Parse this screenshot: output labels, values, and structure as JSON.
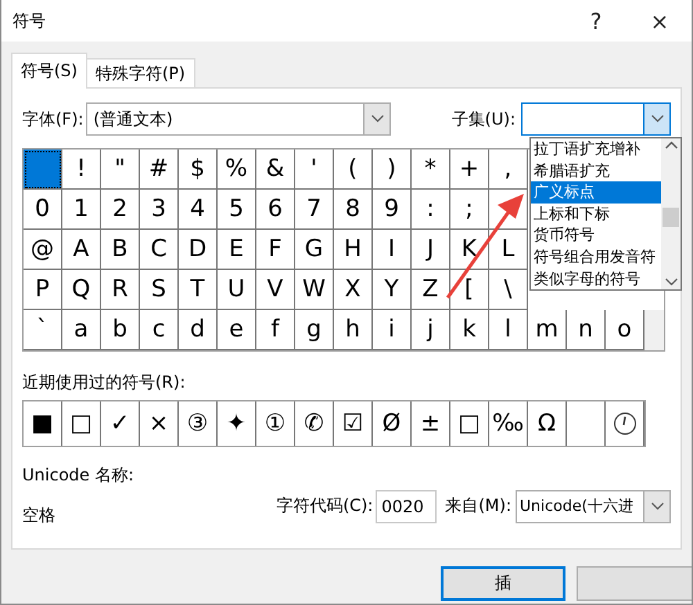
{
  "window": {
    "title": "符号",
    "help": "?",
    "close": "×"
  },
  "tabs": [
    {
      "label": "符号(S)",
      "selected": true
    },
    {
      "label": "特殊字符(P)",
      "selected": false
    }
  ],
  "font": {
    "label": "字体(F):",
    "value": "(普通文本)"
  },
  "subset": {
    "label": "子集(U):",
    "expanded": true,
    "options": [
      {
        "label": "拉丁语扩充增补",
        "selected": false
      },
      {
        "label": "希腊语扩充",
        "selected": false
      },
      {
        "label": "广义标点",
        "selected": true
      },
      {
        "label": "上标和下标",
        "selected": false
      },
      {
        "label": "货币符号",
        "selected": false
      },
      {
        "label": "符号组合用发音符",
        "selected": false
      },
      {
        "label": "类似字母的符号",
        "selected": false
      }
    ]
  },
  "symbol_grid": [
    [
      {
        "selected": true
      },
      {
        "char": "!",
        "selected": false
      },
      {
        "char": "\"",
        "selected": false
      },
      {
        "char": "#",
        "selected": false
      },
      {
        "char": "$",
        "selected": false
      },
      {
        "char": "%",
        "selected": false
      },
      {
        "char": "&",
        "selected": false
      },
      {
        "char": "'",
        "selected": false
      },
      {
        "char": "(",
        "selected": false
      },
      {
        "char": ")",
        "selected": false
      },
      {
        "char": "*",
        "selected": false
      },
      {
        "char": "+",
        "selected": false
      },
      {
        "char": ",",
        "selected": false
      }
    ],
    [
      {
        "char": "0",
        "selected": false
      },
      {
        "char": "1",
        "selected": false
      },
      {
        "char": "2",
        "selected": false
      },
      {
        "char": "3",
        "selected": false
      },
      {
        "char": "4",
        "selected": false
      },
      {
        "char": "5",
        "selected": false
      },
      {
        "char": "6",
        "selected": false
      },
      {
        "char": "7",
        "selected": false
      },
      {
        "char": "8",
        "selected": false
      },
      {
        "char": "9",
        "selected": false
      },
      {
        "char": ":",
        "selected": false
      },
      {
        "char": ";",
        "selected": false
      },
      {
        "selected": false
      }
    ],
    [
      {
        "char": "@",
        "selected": false
      },
      {
        "char": "A",
        "selected": false
      },
      {
        "char": "B",
        "selected": false
      },
      {
        "char": "C",
        "selected": false
      },
      {
        "char": "D",
        "selected": false
      },
      {
        "char": "E",
        "selected": false
      },
      {
        "char": "F",
        "selected": false
      },
      {
        "char": "G",
        "selected": false
      },
      {
        "char": "H",
        "selected": false
      },
      {
        "char": "I",
        "selected": false
      },
      {
        "char": "J",
        "selected": false
      },
      {
        "char": "K",
        "selected": false
      },
      {
        "char": "L",
        "selected": false
      }
    ],
    [
      {
        "char": "P",
        "selected": false
      },
      {
        "char": "Q",
        "selected": false
      },
      {
        "char": "R",
        "selected": false
      },
      {
        "char": "S",
        "selected": false
      },
      {
        "char": "T",
        "selected": false
      },
      {
        "char": "U",
        "selected": false
      },
      {
        "char": "V",
        "selected": false
      },
      {
        "char": "W",
        "selected": false
      },
      {
        "char": "X",
        "selected": false
      },
      {
        "char": "Y",
        "selected": false
      },
      {
        "char": "Z",
        "selected": false
      },
      {
        "char": "[",
        "selected": false
      },
      {
        "char": "\\",
        "selected": false
      }
    ],
    [
      {
        "char": "`",
        "selected": false
      },
      {
        "char": "a",
        "selected": false
      },
      {
        "char": "b",
        "selected": false
      },
      {
        "char": "c",
        "selected": false
      },
      {
        "char": "d",
        "selected": false
      },
      {
        "char": "e",
        "selected": false
      },
      {
        "char": "f",
        "selected": false
      },
      {
        "char": "g",
        "selected": false
      },
      {
        "char": "h",
        "selected": false
      },
      {
        "char": "i",
        "selected": false
      },
      {
        "char": "j",
        "selected": false
      },
      {
        "char": "k",
        "selected": false
      },
      {
        "char": "l",
        "selected": false
      },
      {
        "char": "m",
        "selected": false
      },
      {
        "char": "n",
        "selected": false
      },
      {
        "char": "o",
        "selected": false
      }
    ]
  ],
  "recent": {
    "label": "近期使用过的符号(R):",
    "symbols": [
      {
        "kind": "glyph",
        "char": "■"
      },
      {
        "kind": "glyph",
        "char": "□"
      },
      {
        "kind": "glyph",
        "char": "✓"
      },
      {
        "kind": "glyph",
        "char": "×"
      },
      {
        "kind": "glyph",
        "char": "③"
      },
      {
        "kind": "glyph",
        "char": "✦"
      },
      {
        "kind": "glyph",
        "char": "①"
      },
      {
        "kind": "glyph",
        "char": "✆"
      },
      {
        "kind": "glyph",
        "char": "☑"
      },
      {
        "kind": "glyph",
        "char": "Ø"
      },
      {
        "kind": "glyph",
        "char": "±"
      },
      {
        "kind": "glyph",
        "char": "□"
      },
      {
        "kind": "glyph",
        "char": "‰"
      },
      {
        "kind": "glyph",
        "char": "Ω"
      },
      {
        "kind": "blank"
      },
      {
        "kind": "icon"
      }
    ]
  },
  "unicode_name": {
    "label": "Unicode 名称:",
    "value": "空格"
  },
  "char_code": {
    "label": "字符代码(C):",
    "value": "0020"
  },
  "from": {
    "label": "来自(M):",
    "value": "Unicode(十六进"
  },
  "buttons": [
    {
      "label": "插",
      "default": true
    }
  ]
}
